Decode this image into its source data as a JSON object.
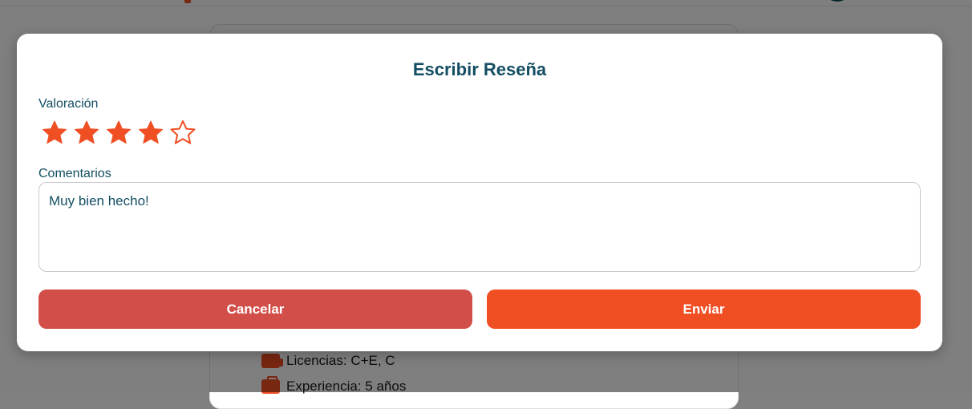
{
  "modal": {
    "title": "Escribir Reseña",
    "rating_label": "Valoración",
    "rating": 4,
    "rating_max": 5,
    "comments_label": "Comentarios",
    "comments_value": "Muy bien hecho!",
    "cancel_label": "Cancelar",
    "send_label": "Enviar"
  },
  "background": {
    "details": [
      {
        "icon": "truck-icon",
        "text": "Licencias: C+E, C"
      },
      {
        "icon": "briefcase-icon",
        "text": "Experiencia: 5 años"
      }
    ]
  },
  "colors": {
    "accent": "#f04e23",
    "cancel": "#d24f49",
    "title": "#134e63"
  }
}
